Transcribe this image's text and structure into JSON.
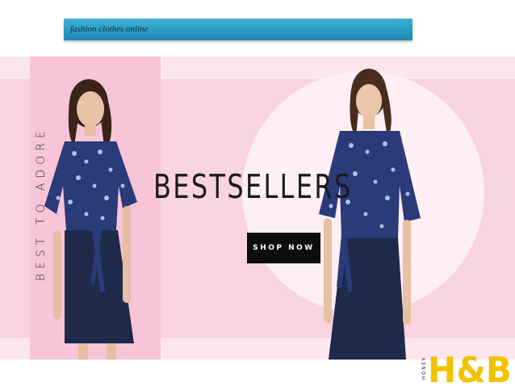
{
  "header": {
    "title": "fashion clothes online"
  },
  "banner": {
    "tagline": "BEST TO ADORE",
    "headline": "BESTSELLERS",
    "cta_label": "SHOP NOW"
  },
  "logo": {
    "text": "H&B",
    "subtext": "HONEY"
  },
  "colors": {
    "title_bar": "#2a9cc4",
    "banner_bg": "#fbe6ee",
    "panel_pink": "#f7c5d7",
    "button_bg": "#0d0d0d",
    "dress_top": "#2b3a78",
    "dress_skirt": "#1f2a4a",
    "logo_yellow": "#f2c200"
  },
  "icons": [
    "model-photo-left",
    "model-photo-right",
    "brand-logo-icon"
  ]
}
